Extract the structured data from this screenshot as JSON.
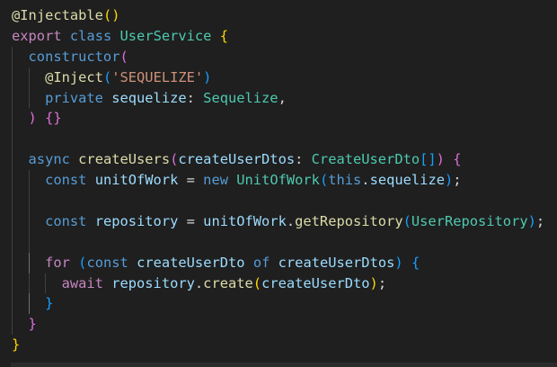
{
  "editor": {
    "lines": [
      {
        "indent": 0,
        "tokens": [
          [
            "@",
            "fn"
          ],
          [
            "Injectable",
            "fn"
          ],
          [
            "(",
            "b1"
          ],
          [
            ")",
            "b1"
          ]
        ]
      },
      {
        "indent": 0,
        "tokens": [
          [
            "export",
            "ctl"
          ],
          [
            " ",
            "pl"
          ],
          [
            "class",
            "kw"
          ],
          [
            " ",
            "pl"
          ],
          [
            "UserService",
            "cls"
          ],
          [
            " ",
            "pl"
          ],
          [
            "{",
            "b1"
          ]
        ]
      },
      {
        "indent": 1,
        "tokens": [
          [
            "constructor",
            "kw"
          ],
          [
            "(",
            "b2"
          ]
        ]
      },
      {
        "indent": 2,
        "tokens": [
          [
            "@",
            "fn"
          ],
          [
            "Inject",
            "fn"
          ],
          [
            "(",
            "b3"
          ],
          [
            "'SEQUELIZE'",
            "str"
          ],
          [
            ")",
            "b3"
          ]
        ]
      },
      {
        "indent": 2,
        "tokens": [
          [
            "private",
            "kw"
          ],
          [
            " ",
            "pl"
          ],
          [
            "sequelize",
            "var"
          ],
          [
            ": ",
            "pl"
          ],
          [
            "Sequelize",
            "cls"
          ],
          [
            ",",
            "pl"
          ]
        ]
      },
      {
        "indent": 1,
        "tokens": [
          [
            ")",
            "b2"
          ],
          [
            " ",
            "pl"
          ],
          [
            "{}",
            "b2"
          ]
        ]
      },
      {
        "indent": 1,
        "tokens": []
      },
      {
        "indent": 1,
        "tokens": [
          [
            "async",
            "kw"
          ],
          [
            " ",
            "pl"
          ],
          [
            "createUsers",
            "fn"
          ],
          [
            "(",
            "b2"
          ],
          [
            "createUserDtos",
            "var"
          ],
          [
            ": ",
            "pl"
          ],
          [
            "CreateUserDto",
            "cls"
          ],
          [
            "[]",
            "b3"
          ],
          [
            ")",
            "b2"
          ],
          [
            " ",
            "pl"
          ],
          [
            "{",
            "b2"
          ]
        ]
      },
      {
        "indent": 2,
        "tokens": [
          [
            "const",
            "kw"
          ],
          [
            " ",
            "pl"
          ],
          [
            "unitOfWork",
            "var"
          ],
          [
            " = ",
            "pl"
          ],
          [
            "new",
            "kw"
          ],
          [
            " ",
            "pl"
          ],
          [
            "UnitOfWork",
            "cls"
          ],
          [
            "(",
            "b3"
          ],
          [
            "this",
            "kw"
          ],
          [
            ".",
            "pl"
          ],
          [
            "sequelize",
            "var"
          ],
          [
            ")",
            "b3"
          ],
          [
            ";",
            "pl"
          ]
        ]
      },
      {
        "indent": 2,
        "tokens": []
      },
      {
        "indent": 2,
        "tokens": [
          [
            "const",
            "kw"
          ],
          [
            " ",
            "pl"
          ],
          [
            "repository",
            "var"
          ],
          [
            " = ",
            "pl"
          ],
          [
            "unitOfWork",
            "var"
          ],
          [
            ".",
            "pl"
          ],
          [
            "getRepository",
            "fn"
          ],
          [
            "(",
            "b3"
          ],
          [
            "UserRepository",
            "cls"
          ],
          [
            ")",
            "b3"
          ],
          [
            ";",
            "pl"
          ]
        ]
      },
      {
        "indent": 2,
        "tokens": []
      },
      {
        "indent": 2,
        "tokens": [
          [
            "for",
            "ctl"
          ],
          [
            " ",
            "pl"
          ],
          [
            "(",
            "b3"
          ],
          [
            "const",
            "kw"
          ],
          [
            " ",
            "pl"
          ],
          [
            "createUserDto",
            "var"
          ],
          [
            " ",
            "pl"
          ],
          [
            "of",
            "kw"
          ],
          [
            " ",
            "pl"
          ],
          [
            "createUserDtos",
            "var"
          ],
          [
            ")",
            "b3"
          ],
          [
            " ",
            "pl"
          ],
          [
            "{",
            "b3"
          ]
        ]
      },
      {
        "indent": 3,
        "tokens": [
          [
            "await",
            "ctl"
          ],
          [
            " ",
            "pl"
          ],
          [
            "repository",
            "var"
          ],
          [
            ".",
            "pl"
          ],
          [
            "create",
            "fn"
          ],
          [
            "(",
            "b1"
          ],
          [
            "createUserDto",
            "var"
          ],
          [
            ")",
            "b1"
          ],
          [
            ";",
            "pl"
          ]
        ]
      },
      {
        "indent": 2,
        "tokens": [
          [
            "}",
            "b3"
          ]
        ]
      },
      {
        "indent": 1,
        "tokens": [
          [
            "}",
            "b2"
          ]
        ]
      },
      {
        "indent": 0,
        "tokens": [
          [
            "}",
            "b1"
          ]
        ]
      }
    ]
  }
}
